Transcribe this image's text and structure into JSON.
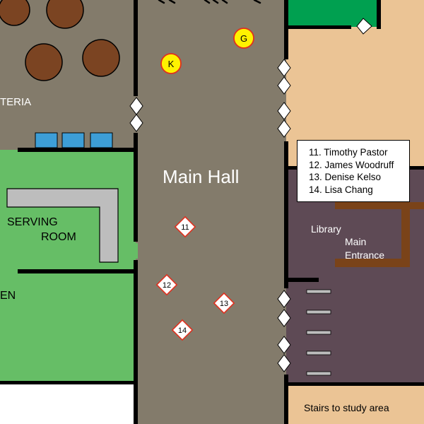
{
  "colors": {
    "cafeteria_floor": "#837B6B",
    "main_hall_floor": "#837B6B",
    "serving_room_floor": "#66BE66",
    "kitchen_floor": "#66BE66",
    "library_floor": "#5E4A55",
    "library_desk": "#7A4319",
    "right_area_floor": "#EBC495",
    "green_room": "#00A050",
    "table": "#7B4422",
    "chair": "#3D9ED7",
    "counter": "#BDBDBD",
    "wall": "#000000",
    "marker_yellow": "#FFF200",
    "marker_red": "#E0301E"
  },
  "rooms": {
    "cafeteria_label": "TERIA",
    "serving_room_label_line1": "SERVING",
    "serving_room_label_line2": "ROOM",
    "kitchen_label": "EN",
    "main_hall_label": "Main Hall",
    "library_label": "Library",
    "main_entrance_line1": "Main",
    "main_entrance_line2": "Entrance",
    "stairs_label": "Stairs to study area"
  },
  "markers": [
    {
      "label": "K",
      "shape": "circle",
      "color": "yellow"
    },
    {
      "label": "G",
      "shape": "circle",
      "color": "yellow"
    },
    {
      "label": "11",
      "shape": "diamond",
      "color": "red"
    },
    {
      "label": "12",
      "shape": "diamond",
      "color": "red"
    },
    {
      "label": "13",
      "shape": "diamond",
      "color": "red"
    },
    {
      "label": "14",
      "shape": "diamond",
      "color": "red"
    }
  ],
  "legend": {
    "items": [
      "11. Timothy Pastor",
      "12. James Woodruff",
      "13. Denise Kelso",
      "14. Lisa Chang"
    ]
  },
  "icons": {
    "door": "door-icon",
    "table": "table-icon",
    "chair": "chair-icon"
  }
}
